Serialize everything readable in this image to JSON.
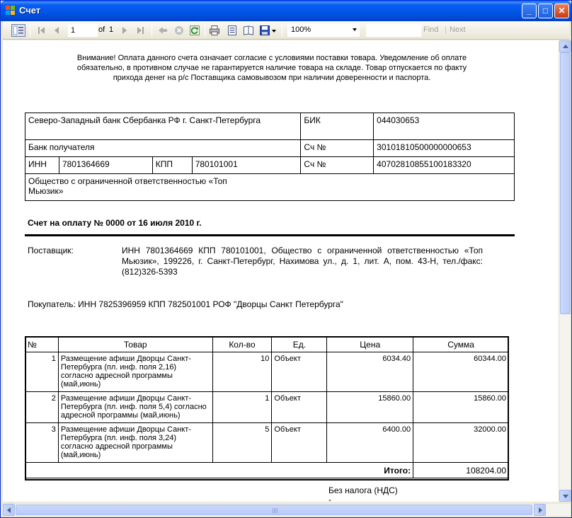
{
  "window": {
    "title": "Счет",
    "minimize": "_",
    "maximize": "□",
    "close": "✕"
  },
  "toolbar": {
    "page_value": "1",
    "of_label": "of",
    "total_pages": "1",
    "zoom": "100%",
    "find_label": "Find",
    "next_label": "Next"
  },
  "report": {
    "notice": "Внимание! Оплата данного счета означает согласие с условиями поставки товара. Уведомление об оплате обязательно, в противном случае не гарантируется наличие товара на складе. Товар отпускается по факту прихода денег на р/с Поставщика самовывозом при наличии доверенности и паспорта.",
    "bank": {
      "bank_name": "Северо-Западный банк Сбербанка РФ г. Санкт-Петербурга",
      "bik_label": "БИК",
      "bik_value": "044030653",
      "recipient_bank_label": "Банк получателя",
      "account_label": "Сч №",
      "corr_account": "30101810500000000653",
      "inn_label": "ИНН",
      "inn_value": "7801364669",
      "kpp_label": "КПП",
      "kpp_value": "780101001",
      "account_label_2": "Сч №",
      "account_value": "40702810855100183320",
      "recipient_name": "Общество с ограниченной ответственностью «Топ Мьюзик»"
    },
    "invoice_title": "Счет на оплату № 0000 от  16 июля 2010 г.",
    "supplier_label": "Поставщик:",
    "supplier_text": "ИНН 7801364669 КПП 780101001, Общество с ограниченной ответственностью «Топ Мьюзик», 199226, г. Санкт-Петербург, Нахимова ул., д. 1, лит. А, пом. 43-Н, тел./факс:(812)326-5393",
    "buyer_text": "Покупатель:  ИНН 7825396959  КПП 782501001  РОФ  \"Дворцы Санкт Петербурга\"",
    "table": {
      "headers": [
        "№",
        "Товар",
        "Кол-во",
        "Ед.",
        "Цена",
        "Сумма"
      ],
      "rows": [
        [
          "1",
          "Размещение афиши Дворцы Санкт-Петербурга (пл. инф. поля 2,16) согласно адресной программы (май,июнь)",
          "10",
          "Объект",
          "6034.40",
          "60344.00"
        ],
        [
          "2",
          "Размещение афиши Дворцы Санкт-Петербурга (пл. инф. поля 5,4) согласно адресной программы (май,июнь)",
          "1",
          "Объект",
          "15860.00",
          "15860.00"
        ],
        [
          "3",
          "Размещение афиши Дворцы Санкт-Петербурга (пл. инф. поля 3,24) согласно адресной программы (май,июнь)",
          "5",
          "Объект",
          "6400.00",
          "32000.00"
        ]
      ],
      "total_label": "Итого:",
      "total_value": "108204.00"
    },
    "tax_note": "Без налога (НДС)",
    "tax_dash": "-"
  }
}
